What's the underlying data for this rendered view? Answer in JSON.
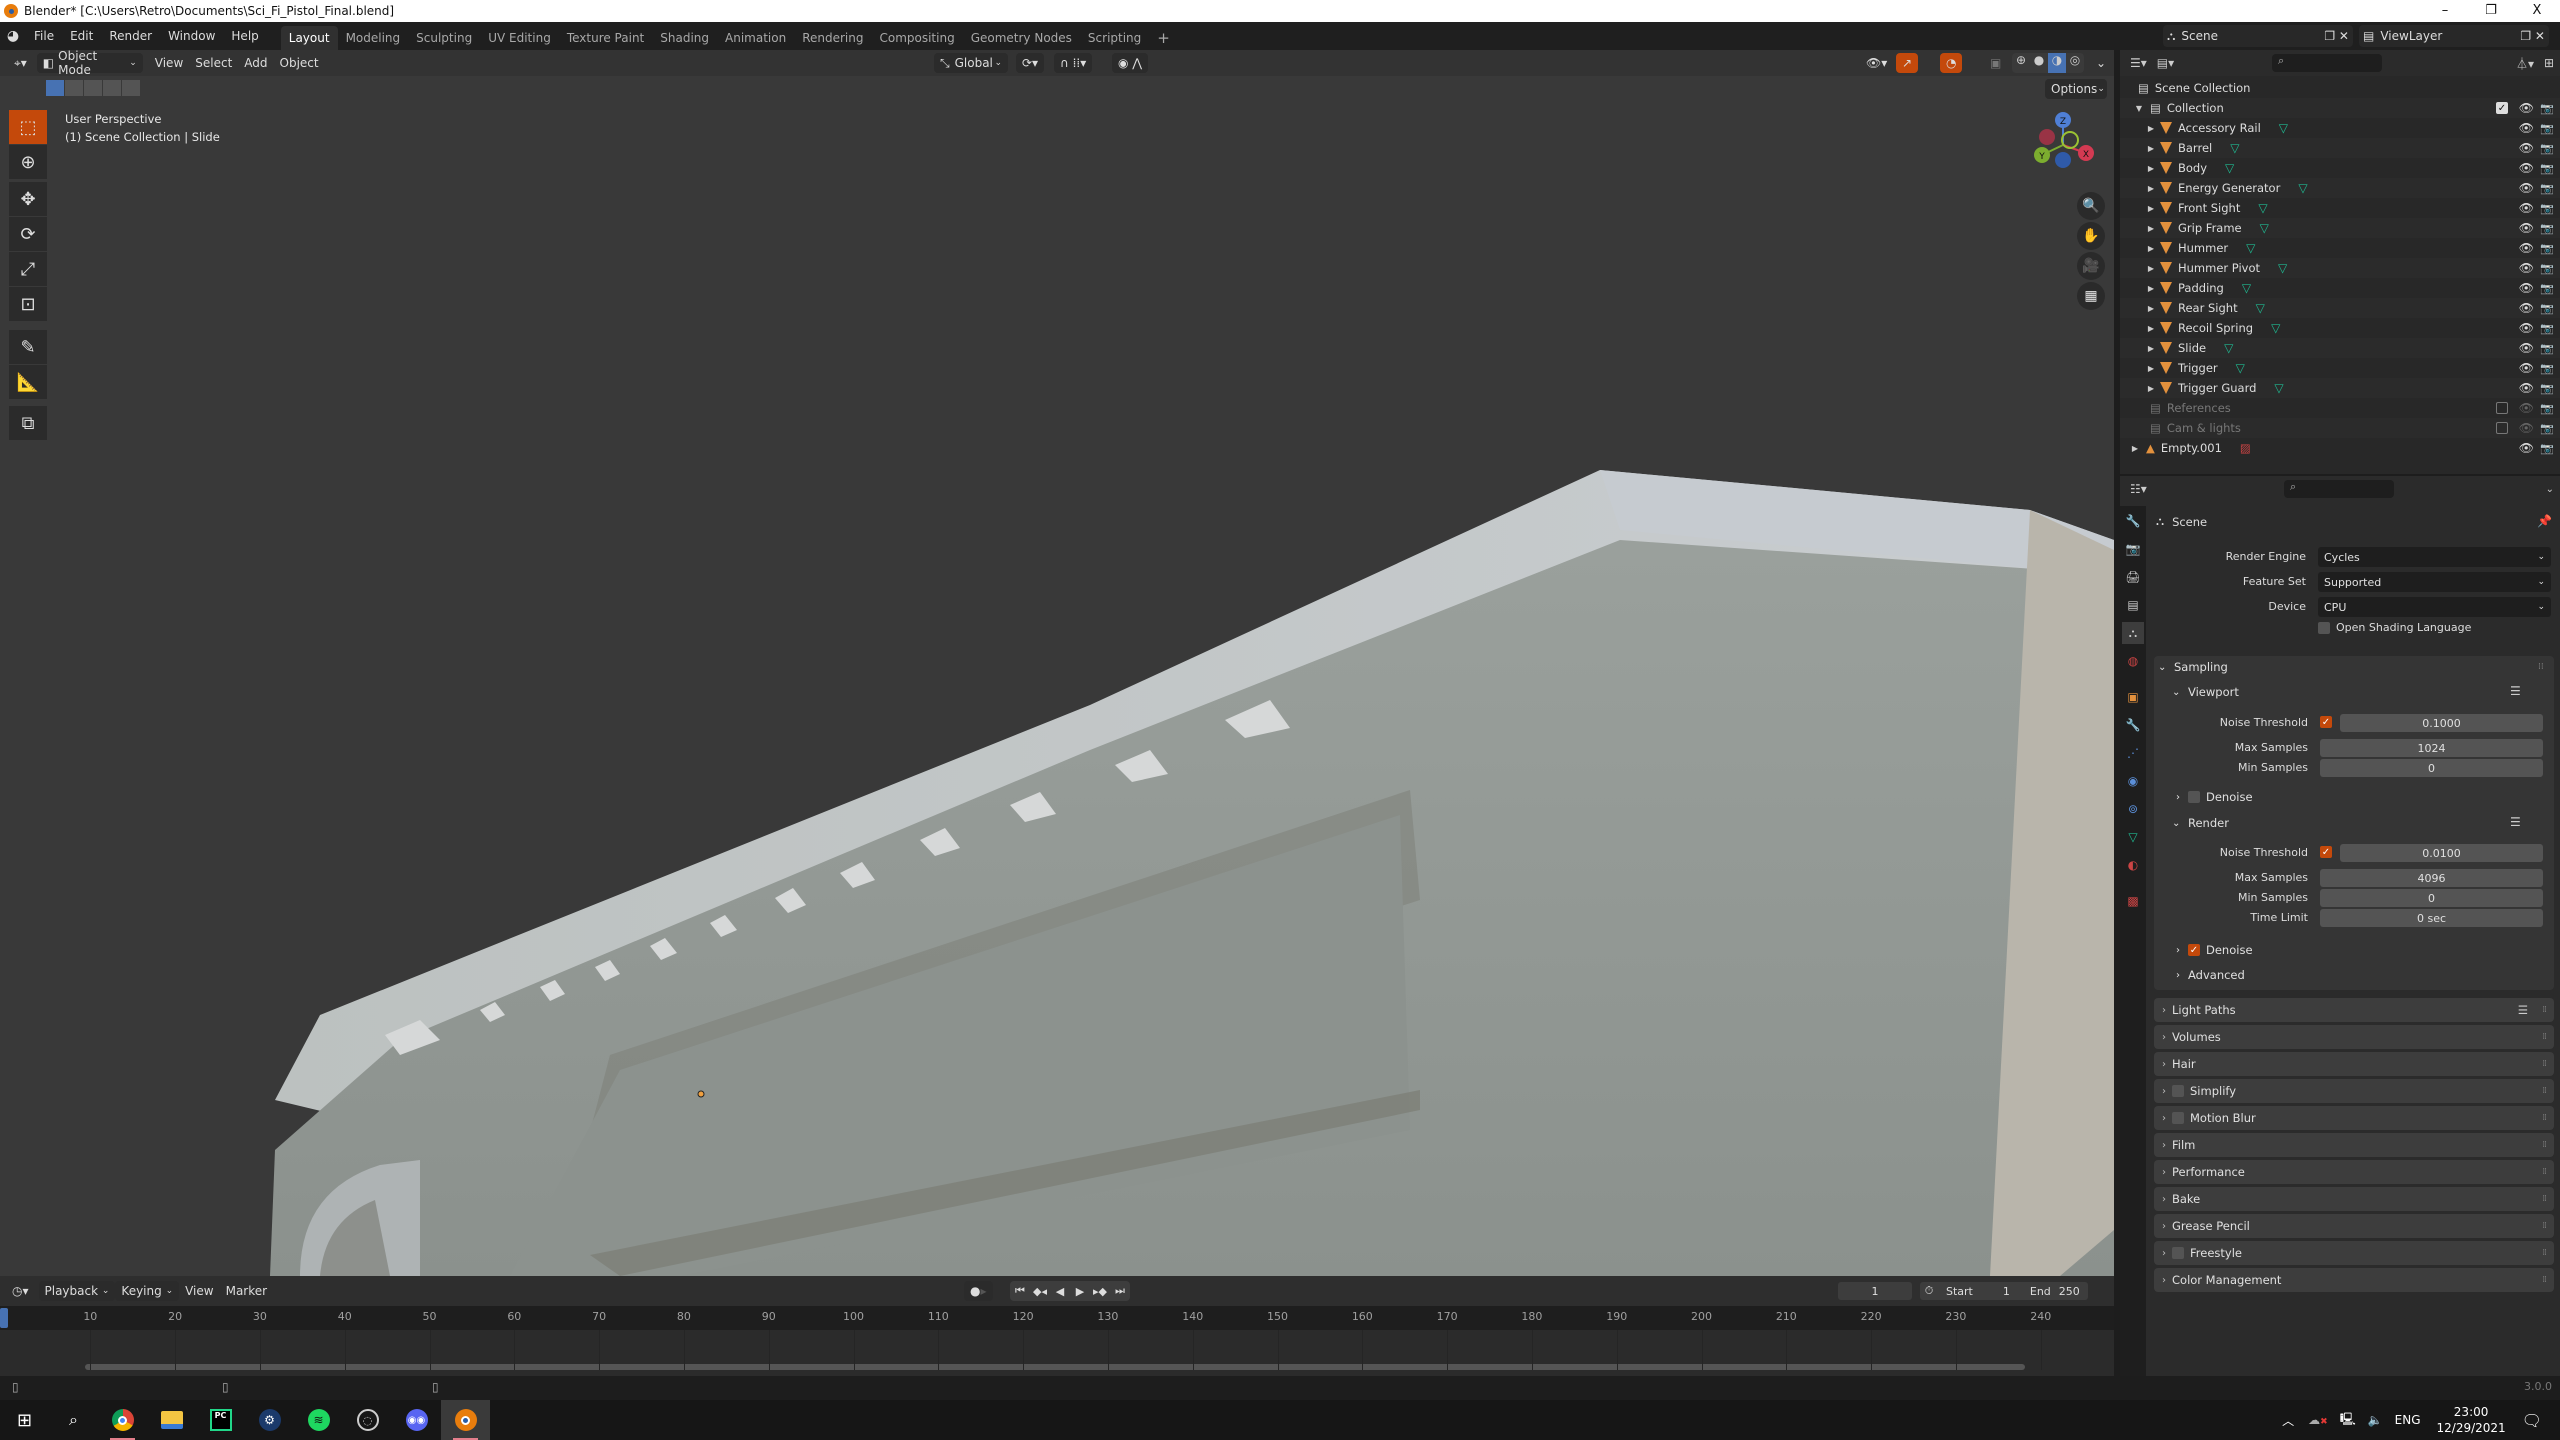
{
  "window": {
    "title": "Blender* [C:\\Users\\Retro\\Documents\\Sci_Fi_Pistol_Final.blend]",
    "controls": [
      "–",
      "❐",
      "X"
    ]
  },
  "menubar": {
    "items": [
      "File",
      "Edit",
      "Render",
      "Window",
      "Help"
    ],
    "workspaces": [
      "Layout",
      "Modeling",
      "Sculpting",
      "UV Editing",
      "Texture Paint",
      "Shading",
      "Animation",
      "Rendering",
      "Compositing",
      "Geometry Nodes",
      "Scripting"
    ],
    "active_workspace": "Layout",
    "add_workspace": "+",
    "scene": "Scene",
    "view_layer": "ViewLayer"
  },
  "viewport": {
    "mode": "Object Mode",
    "menus": [
      "View",
      "Select",
      "Add",
      "Object"
    ],
    "orientation": "Global",
    "options_label": "Options",
    "overlay_line1": "User Perspective",
    "overlay_line2": "(1) Scene Collection | Slide",
    "gizmo": {
      "z": "Z",
      "y": "Y",
      "x": "X"
    },
    "tools": [
      "select-box",
      "cursor",
      "move",
      "rotate",
      "scale",
      "transform",
      "annotate",
      "measure",
      "add-cube"
    ],
    "nav_buttons": [
      "zoom",
      "pan",
      "camera",
      "ortho-grid"
    ],
    "shading_active": "solid-material-preview"
  },
  "outliner": {
    "search_placeholder": "",
    "root": "Scene Collection",
    "collection": "Collection",
    "objects": [
      "Accessory Rail",
      "Barrel",
      "Body",
      "Energy Generator",
      "Front Sight",
      "Grip Frame",
      "Hummer",
      "Hummer Pivot",
      "Padding",
      "Rear Sight",
      "Recoil Spring",
      "Slide",
      "Trigger",
      "Trigger Guard"
    ],
    "selected_object": "Slide",
    "excluded_collections": [
      "References",
      "Cam & lights"
    ],
    "extra_objects": [
      "Empty.001"
    ]
  },
  "properties": {
    "context": "Scene",
    "render_engine_label": "Render Engine",
    "render_engine": "Cycles",
    "feature_set_label": "Feature Set",
    "feature_set": "Supported",
    "device_label": "Device",
    "device": "CPU",
    "osl_label": "Open Shading Language",
    "osl_checked": false,
    "sampling": {
      "title": "Sampling",
      "viewport": {
        "title": "Viewport",
        "noise_threshold_label": "Noise Threshold",
        "noise_threshold_enabled": true,
        "noise_threshold": "0.1000",
        "max_samples_label": "Max Samples",
        "max_samples": "1024",
        "min_samples_label": "Min Samples",
        "min_samples": "0",
        "denoise_label": "Denoise",
        "denoise_checked": false
      },
      "render": {
        "title": "Render",
        "noise_threshold_label": "Noise Threshold",
        "noise_threshold_enabled": true,
        "noise_threshold": "0.0100",
        "max_samples_label": "Max Samples",
        "max_samples": "4096",
        "min_samples_label": "Min Samples",
        "min_samples": "0",
        "time_limit_label": "Time Limit",
        "time_limit": "0 sec",
        "denoise_label": "Denoise",
        "denoise_checked": true
      },
      "advanced_label": "Advanced"
    },
    "panels": [
      {
        "label": "Light Paths",
        "checkbox": false,
        "has_checkbox": false
      },
      {
        "label": "Volumes",
        "has_checkbox": false
      },
      {
        "label": "Hair",
        "has_checkbox": false
      },
      {
        "label": "Simplify",
        "has_checkbox": true
      },
      {
        "label": "Motion Blur",
        "has_checkbox": true
      },
      {
        "label": "Film",
        "has_checkbox": false
      },
      {
        "label": "Performance",
        "has_checkbox": false
      },
      {
        "label": "Bake",
        "has_checkbox": false
      },
      {
        "label": "Grease Pencil",
        "has_checkbox": false
      },
      {
        "label": "Freestyle",
        "has_checkbox": true
      },
      {
        "label": "Color Management",
        "has_checkbox": false
      }
    ]
  },
  "timeline": {
    "menus": [
      "Playback",
      "Keying",
      "View",
      "Marker"
    ],
    "current_frame": "1",
    "start_label": "Start",
    "start": "1",
    "end_label": "End",
    "end": "250",
    "ticks": [
      "10",
      "20",
      "30",
      "40",
      "50",
      "60",
      "70",
      "80",
      "90",
      "100",
      "110",
      "120",
      "130",
      "140",
      "150",
      "160",
      "170",
      "180",
      "190",
      "200",
      "210",
      "220",
      "230",
      "240"
    ]
  },
  "statusbar": {
    "version": "3.0.0"
  },
  "taskbar": {
    "apps": [
      "Start",
      "Search",
      "Chrome",
      "File Explorer",
      "PyCharm",
      "Steam",
      "Spotify",
      "OBS",
      "Discord",
      "Blender"
    ],
    "active_app": "Blender",
    "language": "ENG",
    "time": "23:00",
    "date": "12/29/2021"
  },
  "colors": {
    "accent_orange": "#c4490b",
    "accent_blue": "#4772b3",
    "mesh_orange": "#e3913d",
    "mesh_data_green": "#1fb890"
  }
}
